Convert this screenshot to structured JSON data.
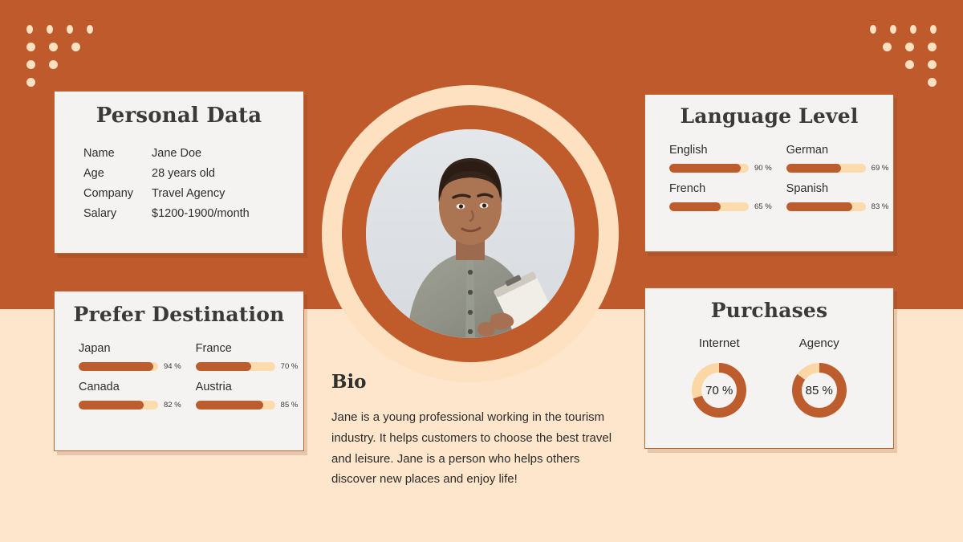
{
  "theme": {
    "orange": "#be5a2c",
    "cream": "#fde6cc",
    "bar_track": "#fcdcad",
    "bar_fill": "#bd5c2c",
    "card_bg": "#f4f3f1",
    "text_dark": "#2f2e2c"
  },
  "personal": {
    "title": "Personal Data",
    "rows": [
      {
        "label": "Name",
        "value": "Jane Doe"
      },
      {
        "label": "Age",
        "value": "28 years old"
      },
      {
        "label": "Company",
        "value": "Travel Agency"
      },
      {
        "label": "Salary",
        "value": "$1200-1900/month"
      }
    ]
  },
  "language": {
    "title": "Language Level",
    "items": [
      {
        "name": "English",
        "pct": 90,
        "pct_label": "90 %"
      },
      {
        "name": "German",
        "pct": 69,
        "pct_label": "69 %"
      },
      {
        "name": "French",
        "pct": 65,
        "pct_label": "65 %"
      },
      {
        "name": "Spanish",
        "pct": 83,
        "pct_label": "83 %"
      }
    ]
  },
  "destination": {
    "title": "Prefer Destination",
    "items": [
      {
        "name": "Japan",
        "pct": 94,
        "pct_label": "94 %"
      },
      {
        "name": "France",
        "pct": 70,
        "pct_label": "70 %"
      },
      {
        "name": "Canada",
        "pct": 82,
        "pct_label": "82 %"
      },
      {
        "name": "Austria",
        "pct": 85,
        "pct_label": "85 %"
      }
    ]
  },
  "purchases": {
    "title": "Purchases",
    "items": [
      {
        "name": "Internet",
        "pct": 70,
        "pct_label": "70 %"
      },
      {
        "name": "Agency",
        "pct": 85,
        "pct_label": "85 %"
      }
    ]
  },
  "bio": {
    "title": "Bio",
    "text": "Jane is a young professional working in the tourism industry. It helps customers to choose the best travel and leisure. Jane is a person who helps others discover new places and enjoy life!"
  },
  "photo": {
    "alt": "portrait-of-woman-holding-clipboard"
  },
  "decor": {
    "dots_left_rows": [
      4,
      3,
      2,
      1
    ],
    "dots_right_rows": [
      4,
      3,
      2,
      1
    ]
  },
  "chart_data": [
    {
      "type": "bar",
      "title": "Language Level",
      "orientation": "horizontal",
      "categories": [
        "English",
        "German",
        "French",
        "Spanish"
      ],
      "values": [
        90,
        69,
        65,
        83
      ],
      "unit": "%",
      "xlim": [
        0,
        100
      ],
      "grid": false,
      "legend": "none"
    },
    {
      "type": "bar",
      "title": "Prefer Destination",
      "orientation": "horizontal",
      "categories": [
        "Japan",
        "France",
        "Canada",
        "Austria"
      ],
      "values": [
        94,
        70,
        82,
        85
      ],
      "unit": "%",
      "xlim": [
        0,
        100
      ],
      "grid": false,
      "legend": "none"
    },
    {
      "type": "pie",
      "subtype": "donut",
      "title": "Purchases",
      "categories": [
        "Internet",
        "Agency"
      ],
      "values": [
        70,
        85
      ],
      "unit": "%",
      "legend": "none"
    }
  ]
}
